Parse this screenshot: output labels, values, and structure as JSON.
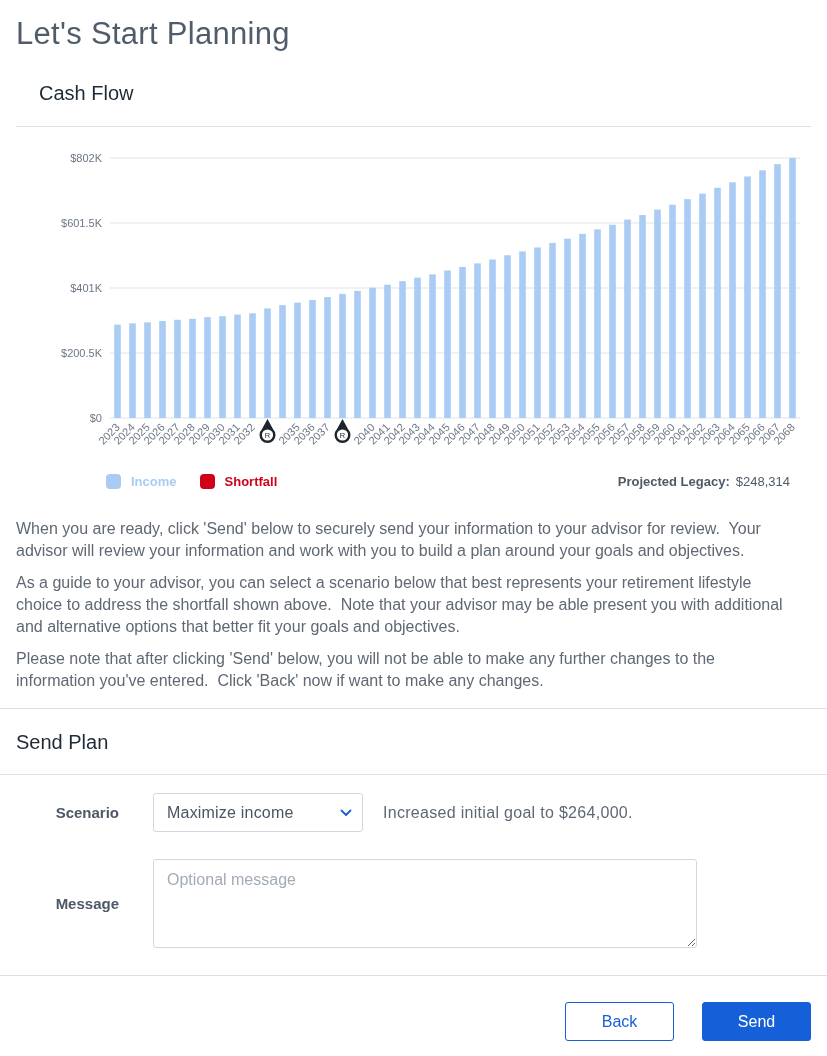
{
  "page": {
    "title": "Let's Start Planning"
  },
  "cash_flow": {
    "title": "Cash Flow",
    "chart_data": {
      "type": "bar",
      "grid": true,
      "categories": [
        "2023",
        "2024",
        "2025",
        "2026",
        "2027",
        "2028",
        "2029",
        "2030",
        "2031",
        "2032",
        null,
        null,
        "2035",
        "2036",
        "2037",
        null,
        null,
        "2040",
        "2041",
        "2042",
        "2043",
        "2044",
        "2045",
        "2046",
        "2047",
        "2048",
        "2049",
        "2050",
        "2051",
        "2052",
        "2053",
        "2054",
        "2055",
        "2056",
        "2057",
        "2058",
        "2059",
        "2060",
        "2061",
        "2062",
        "2063",
        "2064",
        "2065",
        "2066",
        "2067",
        "2068"
      ],
      "series": [
        {
          "name": "Income",
          "color": "#aacbf3",
          "values": [
            288,
            292,
            295,
            299,
            303,
            306,
            311,
            314,
            319,
            323,
            338,
            348,
            356,
            364,
            373,
            383,
            392,
            402,
            411,
            422,
            433,
            443,
            455,
            466,
            477,
            489,
            502,
            514,
            526,
            540,
            553,
            568,
            582,
            596,
            612,
            626,
            643,
            658,
            675,
            692,
            710,
            727,
            745,
            764,
            783,
            802
          ]
        },
        {
          "name": "Shortfall",
          "color": "#d0021b",
          "values": [
            null,
            null,
            null,
            null,
            null,
            null,
            null,
            null,
            null,
            null,
            null,
            null,
            null,
            null,
            null,
            null,
            null,
            null,
            null,
            null,
            null,
            null,
            null,
            null,
            null,
            null,
            null,
            null,
            null,
            null,
            null,
            null,
            null,
            null,
            null,
            null,
            null,
            null,
            null,
            null,
            null,
            null,
            null,
            null,
            null,
            null
          ]
        }
      ],
      "ylim": [
        0,
        802
      ],
      "yticks": [
        {
          "value": 0,
          "label": "$0"
        },
        {
          "value": 200.5,
          "label": "$200.5K"
        },
        {
          "value": 401,
          "label": "$401K"
        },
        {
          "value": 601.5,
          "label": "$601.5K"
        },
        {
          "value": 802,
          "label": "$802K"
        }
      ],
      "annotations": [
        "R",
        "R"
      ]
    },
    "projected_legacy": {
      "label": "Projected Legacy:",
      "value": "$248,314"
    }
  },
  "paragraphs": [
    "When you are ready, click 'Send' below to securely send your information to your advisor for review.  Your advisor will review your information and work with you to build a plan around your goals and objectives.",
    "As a guide to your advisor, you can select a scenario below that best represents your retirement lifestyle choice to address the shortfall shown above.  Note that your advisor may be able present you with additional and alternative options that better fit your goals and objectives.",
    "Please note that after clicking 'Send' below, you will not be able to make any further changes to the information you've entered.  Click 'Back' now if want to make any changes."
  ],
  "send_plan": {
    "title": "Send Plan",
    "scenario": {
      "label": "Scenario",
      "value": "Maximize income",
      "note": "Increased initial goal to $264,000."
    },
    "message": {
      "label": "Message",
      "placeholder": "Optional message"
    }
  },
  "buttons": [
    {
      "label": "Back",
      "kind": "secondary"
    },
    {
      "label": "Send",
      "kind": "primary"
    }
  ]
}
